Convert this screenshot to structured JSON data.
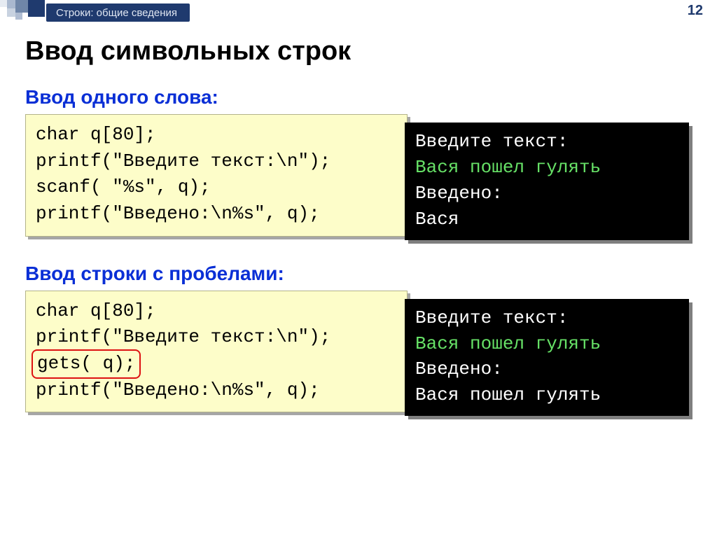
{
  "header": {
    "breadcrumb": "Строки: общие сведения",
    "page_number": "12"
  },
  "title": "Ввод символьных строк",
  "section1": {
    "heading": "Ввод одного слова:",
    "code": "char q[80];\nprintf(\"Введите текст:\\n\");\nscanf( \"%s\", q);\nprintf(\"Введено:\\n%s\", q);",
    "term_line1": "Введите текст:",
    "term_line2": "Вася пошел гулять",
    "term_line3": "Введено:",
    "term_line4": "Вася"
  },
  "section2": {
    "heading": "Ввод строки с пробелами:",
    "code_l1": "char q[80];",
    "code_l2": "printf(\"Введите текст:\\n\");",
    "code_l3": "gets( q);",
    "code_l4": "printf(\"Введено:\\n%s\", q);",
    "term_line1": "Введите текст:",
    "term_line2": "Вася пошел гулять",
    "term_line3": "Введено:",
    "term_line4": "Вася пошел гулять"
  }
}
